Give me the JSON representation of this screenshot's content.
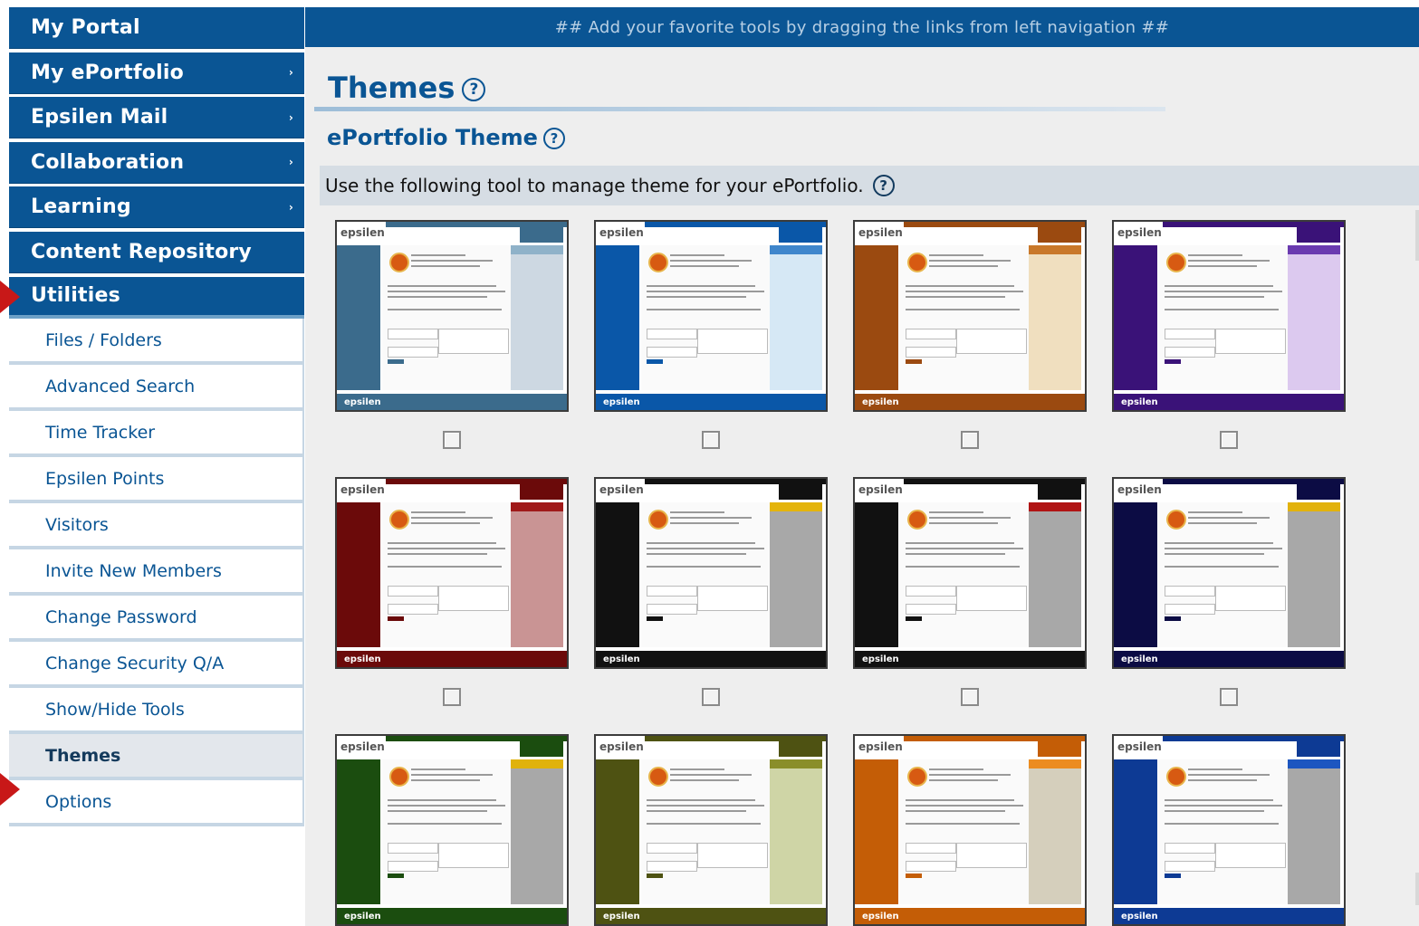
{
  "sidebar": {
    "main_items": [
      {
        "label": "My Portal",
        "has_arrow": false
      },
      {
        "label": "My ePortfolio",
        "has_arrow": true
      },
      {
        "label": "Epsilen Mail",
        "has_arrow": true
      },
      {
        "label": "Collaboration",
        "has_arrow": true
      },
      {
        "label": "Learning",
        "has_arrow": true
      },
      {
        "label": "Content Repository",
        "has_arrow": false
      },
      {
        "label": "Utilities",
        "has_arrow": false
      }
    ],
    "arrow_glyph": "›",
    "sub_items": [
      {
        "label": "Files / Folders"
      },
      {
        "label": "Advanced Search"
      },
      {
        "label": "Time Tracker"
      },
      {
        "label": "Epsilen Points"
      },
      {
        "label": "Visitors"
      },
      {
        "label": "Invite New Members"
      },
      {
        "label": "Change Password"
      },
      {
        "label": "Change Security Q/A"
      },
      {
        "label": "Show/Hide Tools"
      },
      {
        "label": "Themes"
      },
      {
        "label": "Options"
      }
    ],
    "selected_sub": "Themes"
  },
  "banner": {
    "text": "## Add your favorite tools by dragging the links from left navigation ##"
  },
  "page": {
    "title": "Themes",
    "help_glyph": "?",
    "section_title": "ePortfolio Theme",
    "description": "Use the following tool to manage theme for your ePortfolio."
  },
  "themes": {
    "logo_text": "epsilen",
    "items": [
      {
        "name": "steel-blue",
        "primary": "#3b6b8c",
        "accent": "#8fb2c9",
        "panel": "#cdd8e2",
        "checked": false
      },
      {
        "name": "blue",
        "primary": "#0a57a8",
        "accent": "#3f86cc",
        "panel": "#d6e8f5",
        "checked": false
      },
      {
        "name": "rust",
        "primary": "#9b4a10",
        "accent": "#c9782a",
        "panel": "#f0dfbf",
        "checked": false
      },
      {
        "name": "purple",
        "primary": "#3a1278",
        "accent": "#6a3ab0",
        "panel": "#dcc9ef",
        "checked": false
      },
      {
        "name": "maroon",
        "primary": "#6b0a0a",
        "accent": "#a01a1a",
        "panel": "#c99494",
        "checked": false
      },
      {
        "name": "black-yellow",
        "primary": "#111111",
        "accent": "#e4b40c",
        "panel": "#a8a8a8",
        "checked": false
      },
      {
        "name": "black-red",
        "primary": "#111111",
        "accent": "#b01414",
        "panel": "#a8a8a8",
        "checked": false
      },
      {
        "name": "navy-yellow",
        "primary": "#0c0c44",
        "accent": "#e2b20c",
        "panel": "#a8a8a8",
        "checked": false
      },
      {
        "name": "green",
        "primary": "#1b4d0f",
        "accent": "#e0b20c",
        "panel": "#a8a8a8",
        "checked": false
      },
      {
        "name": "olive",
        "primary": "#4e5212",
        "accent": "#8a8e2a",
        "panel": "#cfd5a6",
        "checked": false
      },
      {
        "name": "orange",
        "primary": "#c45d06",
        "accent": "#ec8c20",
        "panel": "#d5cfbc",
        "checked": false
      },
      {
        "name": "royal-blue",
        "primary": "#0d3a94",
        "accent": "#1d56c0",
        "panel": "#a8a8a8",
        "checked": false
      }
    ]
  }
}
